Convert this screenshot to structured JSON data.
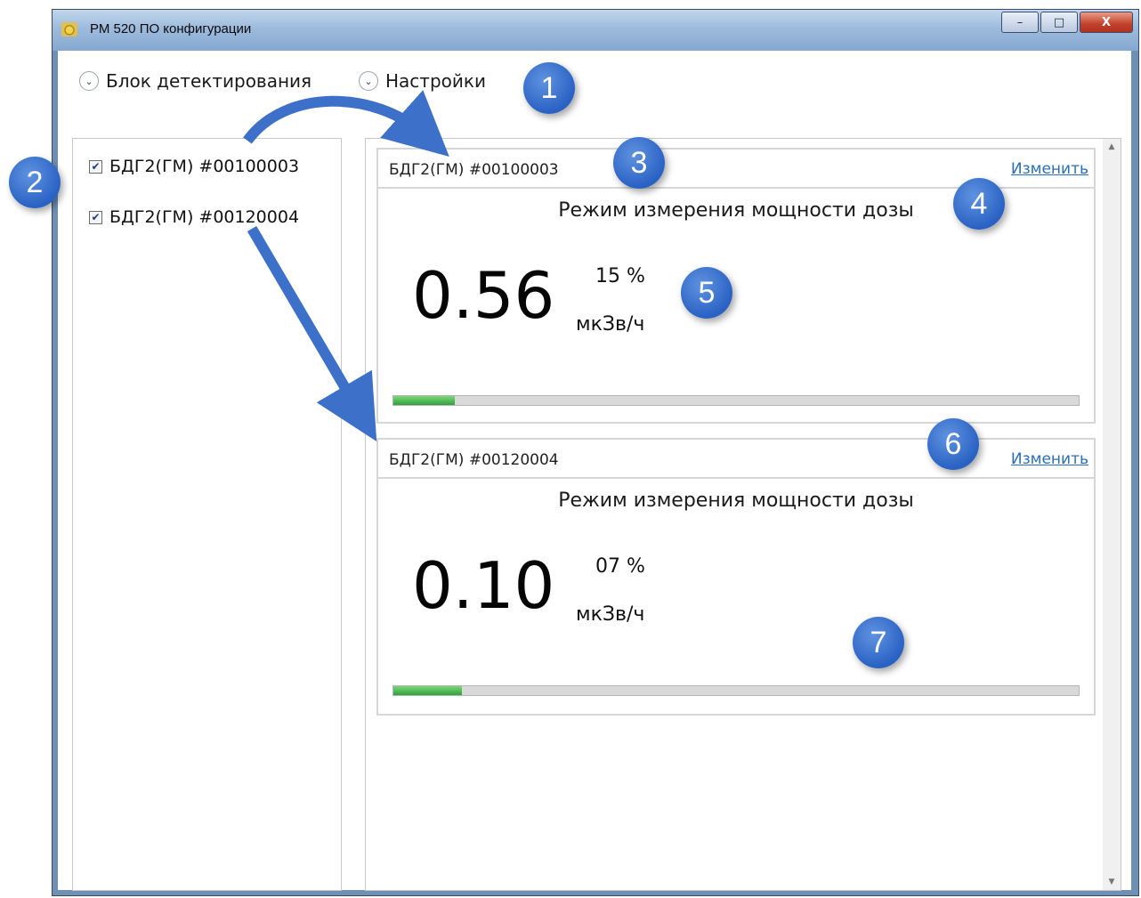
{
  "window": {
    "title": "РМ 520 ПО конфигурации",
    "minimize": "–",
    "maximize": "□",
    "close": "X"
  },
  "menu": {
    "items": [
      {
        "label": "Блок детектирования"
      },
      {
        "label": "Настройки"
      }
    ]
  },
  "detectors": [
    {
      "label": "БДГ2(ГМ) #00100003",
      "checked": true
    },
    {
      "label": "БДГ2(ГМ) #00120004",
      "checked": true
    }
  ],
  "cards": [
    {
      "title": "БДГ2(ГМ) #00100003",
      "change": "Изменить",
      "mode": "Режим измерения мощности дозы",
      "value": "0.56",
      "percent": "15 %",
      "unit": "мкЗв/ч",
      "progress_fraction": 0.09
    },
    {
      "title": "БДГ2(ГМ) #00120004",
      "change": "Изменить",
      "mode": "Режим измерения мощности дозы",
      "value": "0.10",
      "percent": "07 %",
      "unit": "мкЗв/ч",
      "progress_fraction": 0.1
    }
  ],
  "markers": [
    "1",
    "2",
    "3",
    "4",
    "5",
    "6",
    "7"
  ],
  "colors": {
    "marker": "#2a62c4",
    "link": "#2a6fb9",
    "progress_fill": "#2ea23a"
  }
}
